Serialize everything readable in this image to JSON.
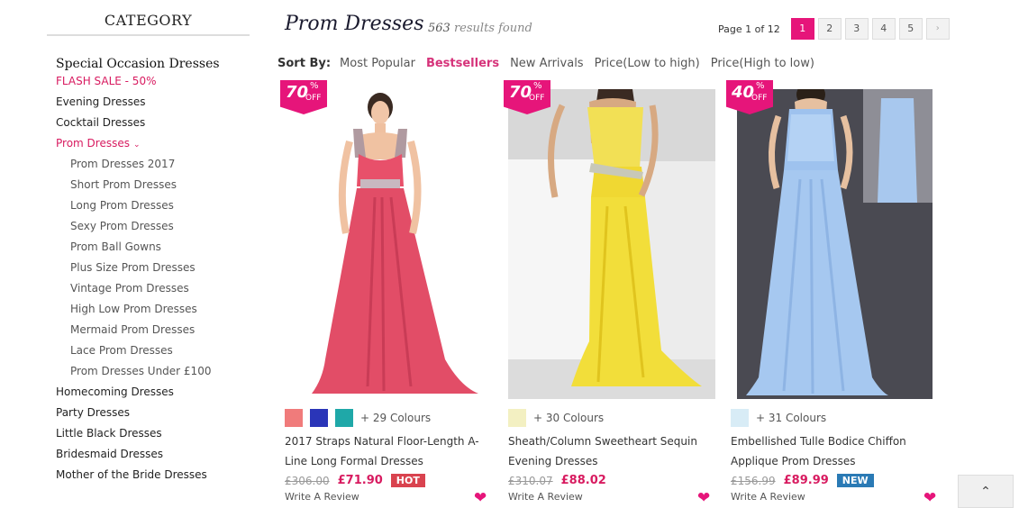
{
  "sidebar": {
    "title": "CATEGORY",
    "heading": "Special Occasion Dresses",
    "items": [
      {
        "label": "FLASH SALE - 50%"
      },
      {
        "label": "Evening Dresses"
      },
      {
        "label": "Cocktail Dresses"
      },
      {
        "label": "Prom Dresses"
      },
      {
        "label": "Prom Dresses 2017"
      },
      {
        "label": "Short Prom Dresses"
      },
      {
        "label": "Long Prom Dresses"
      },
      {
        "label": "Sexy Prom Dresses"
      },
      {
        "label": "Prom Ball Gowns"
      },
      {
        "label": "Plus Size Prom Dresses"
      },
      {
        "label": "Vintage Prom Dresses"
      },
      {
        "label": "High Low Prom Dresses"
      },
      {
        "label": "Mermaid Prom Dresses"
      },
      {
        "label": "Lace Prom Dresses"
      },
      {
        "label": "Prom Dresses Under £100"
      },
      {
        "label": "Homecoming Dresses"
      },
      {
        "label": "Party Dresses"
      },
      {
        "label": "Little Black Dresses"
      },
      {
        "label": "Bridesmaid Dresses"
      },
      {
        "label": "Mother of the Bride Dresses"
      }
    ]
  },
  "header": {
    "title": "Prom Dresses",
    "results_count": "563",
    "results_suffix": "results found",
    "page_text": "Page 1 of 12",
    "pages": [
      "1",
      "2",
      "3",
      "4",
      "5"
    ],
    "next_icon": "chevron-right-icon"
  },
  "sort": {
    "label": "Sort By:",
    "options": [
      "Most Popular",
      "Bestsellers",
      "New Arrivals",
      "Price(Low to high)",
      "Price(High to low)"
    ],
    "active": "Bestsellers"
  },
  "products": [
    {
      "discount": "70",
      "percent_sign": "%",
      "off": "OFF",
      "swatches": [
        "#f07b7b",
        "#2a35b8",
        "#1fa8a8"
      ],
      "colours": "+ 29 Colours",
      "name": "2017 Straps Natural Floor-Length A-Line Long Formal Dresses",
      "old_price": "£306.00",
      "price": "£71.90",
      "tag": "HOT",
      "review": "Write A Review"
    },
    {
      "discount": "70",
      "percent_sign": "%",
      "off": "OFF",
      "swatches": [
        "#f3f0c2"
      ],
      "colours": "+ 30 Colours",
      "name": "Sheath/Column Sweetheart Sequin Evening Dresses",
      "old_price": "£310.07",
      "price": "£88.02",
      "tag": "",
      "review": "Write A Review"
    },
    {
      "discount": "40",
      "percent_sign": "%",
      "off": "OFF",
      "swatches": [
        "#d8ecf6"
      ],
      "colours": "+ 31 Colours",
      "name": "Embellished Tulle Bodice Chiffon Applique Prom Dresses",
      "old_price": "£156.99",
      "price": "£89.99",
      "tag": "NEW",
      "review": "Write A Review"
    }
  ],
  "colors": {
    "accent": "#e6157a",
    "hot_tag": "#d9434f",
    "new_tag": "#2a7ab5"
  },
  "back_to_top_icon": "chevron-up-icon"
}
